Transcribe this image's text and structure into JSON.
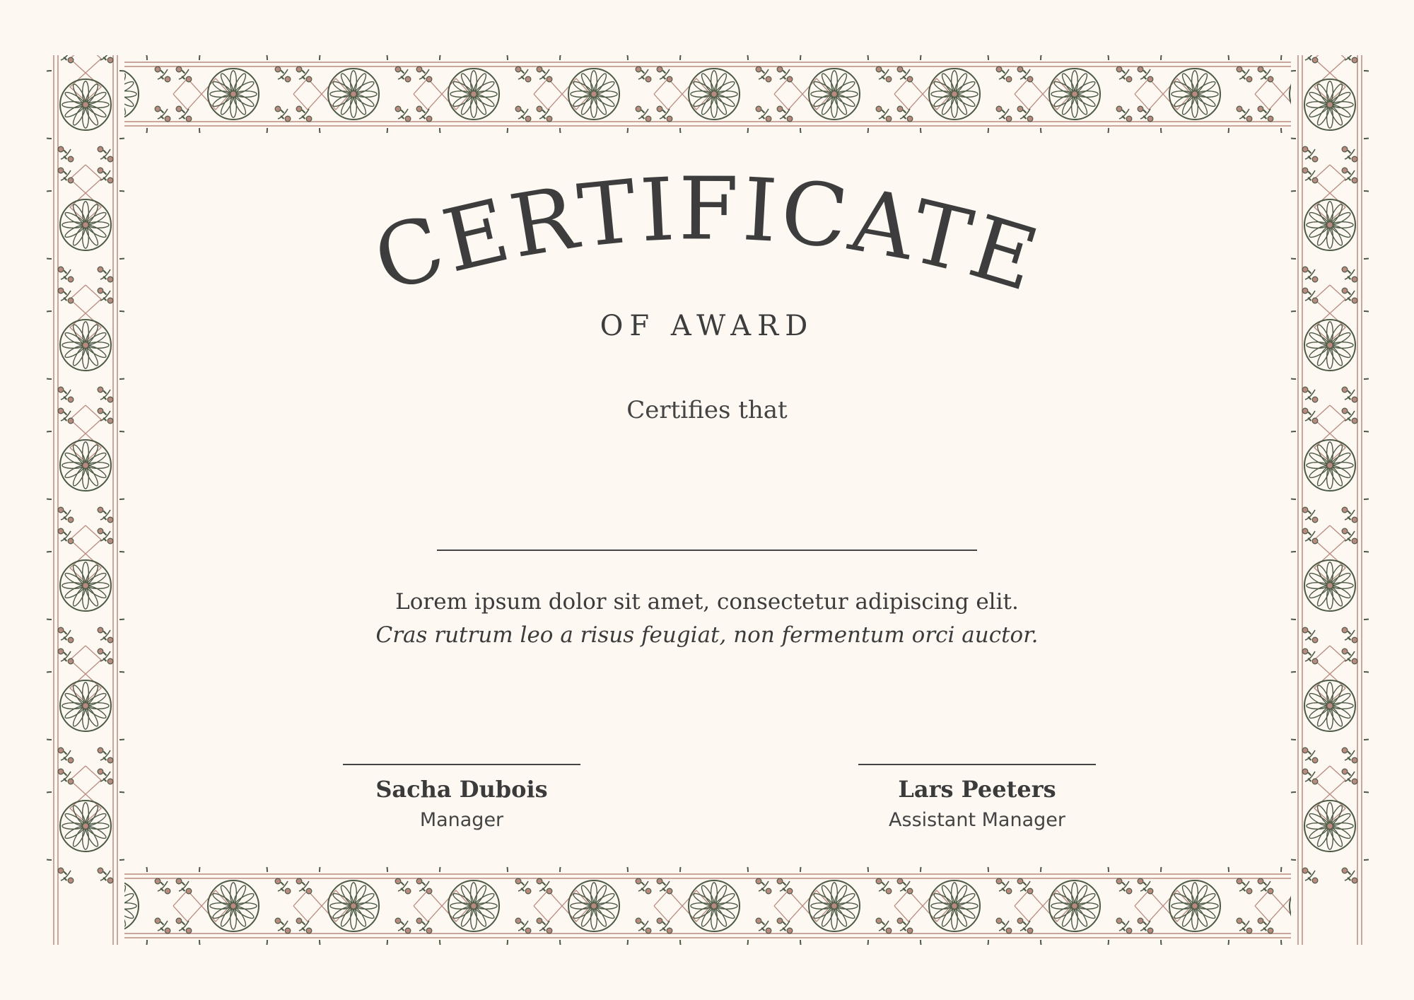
{
  "certificate": {
    "title": "CERTIFICATE",
    "subtitle": "OF AWARD",
    "intro": "Certifies that",
    "body_line_1": "Lorem ipsum dolor sit amet, consectetur adipiscing elit.",
    "body_line_2": "Cras rutrum leo a risus feugiat, non fermentum orci auctor."
  },
  "signatories": [
    {
      "name": "Sacha Dubois",
      "role": "Manager"
    },
    {
      "name": "Lars Peeters",
      "role": "Assistant Manager"
    }
  ],
  "colors": {
    "background": "#fdf8f2",
    "text": "#3d3d3d",
    "ornament_green": "#4d5a45",
    "ornament_rose": "#b98a80"
  },
  "icons": {
    "border": "floral-ornament-border"
  }
}
